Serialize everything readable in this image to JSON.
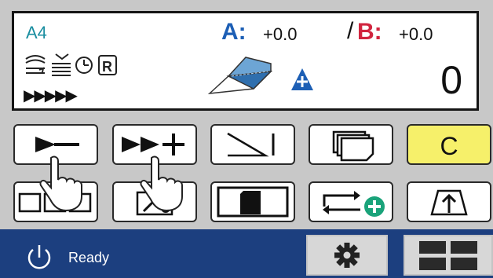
{
  "display": {
    "paper_size": "A4",
    "a_label": "A:",
    "a_value": "+0.0",
    "slash": "/",
    "b_label": "B:",
    "b_value": "+0.0",
    "count": "0",
    "progress_arrows": "▶▶▶▶▶",
    "status_icons": [
      "stacker-icon",
      "sheet-stack-icon",
      "timer-icon",
      "r-mode-icon"
    ],
    "center_graphic": "folded-sheet-icon",
    "plus_badge_icon": "plus-triangle-icon"
  },
  "keys": {
    "row1": [
      {
        "name": "feed-minus-key",
        "icon": "arrow-minus-icon"
      },
      {
        "name": "feed-plus-key",
        "icon": "double-arrow-plus-icon"
      },
      {
        "name": "ramp-key",
        "icon": "ramp-icon"
      },
      {
        "name": "stack-key",
        "icon": "stacked-pages-icon"
      },
      {
        "name": "clear-key",
        "label": "C"
      }
    ],
    "row2": [
      {
        "name": "fold-pattern-key",
        "icon": "fold-pattern-icon"
      },
      {
        "name": "edit-key",
        "icon": "pencil-sheet-icon"
      },
      {
        "name": "card-key",
        "icon": "card-icon"
      },
      {
        "name": "loop-add-key",
        "icon": "loop-plus-icon"
      },
      {
        "name": "tray-up-key",
        "icon": "tray-up-icon"
      }
    ]
  },
  "bottom_bar": {
    "status": "Ready",
    "power_icon": "power-icon",
    "settings_icon": "gear-icon",
    "menu_icon": "grid-icon"
  },
  "colors": {
    "a_accent": "#1d5fb5",
    "b_accent": "#d1253f",
    "paper_text": "#1a8ea0",
    "bar": "#1c3f7f",
    "clear_key": "#f6f06a"
  }
}
